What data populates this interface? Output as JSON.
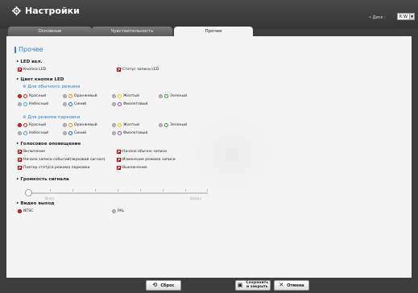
{
  "app": {
    "title": "Настройки"
  },
  "disk": {
    "label": "• Диск :",
    "value": "K:W"
  },
  "tabs": [
    {
      "label": "Основные"
    },
    {
      "label": "Чувствительность"
    },
    {
      "label": "Прочее"
    }
  ],
  "section_title": "Прочее",
  "led": {
    "title": "• LED вкл.",
    "items": [
      "Кнопка LED",
      "Статус записи LED"
    ]
  },
  "button_color": {
    "title": "• Цвет кнопки LED",
    "normal_title": "※ Для обычного режима",
    "parking_title": "※ Для режима парковки",
    "row1": [
      "Красный",
      "Оранжевый",
      "Желтый",
      "Зеленый"
    ],
    "row2": [
      "Небесный",
      "Синий",
      "Фиолетовый"
    ],
    "colors": {
      "red": "#e02020",
      "orange": "#f08a00",
      "yellow": "#e8c800",
      "green": "#20a020",
      "sky": "#3aa0e0",
      "blue": "#2060d0",
      "violet": "#9040c0"
    }
  },
  "voice": {
    "title": "• Голосовое оповещение",
    "left": [
      "Включение",
      "Начало записи событий(звуковой сигнал)",
      "Повтор статуса режима парковки"
    ],
    "right": [
      "Начало обычно записи",
      "Изменение режима записи",
      "Выключение"
    ]
  },
  "volume": {
    "title": "• Громкость сигнала",
    "min_label": "Вниз",
    "max_label": "Вверх"
  },
  "video_out": {
    "title": "• Видео выход",
    "options": [
      "NTSC",
      "PAL"
    ]
  },
  "footer": {
    "reset": "Сброс",
    "save_line1": "Сохранить",
    "save_line2": "и закрыть",
    "cancel": "Отмена"
  }
}
